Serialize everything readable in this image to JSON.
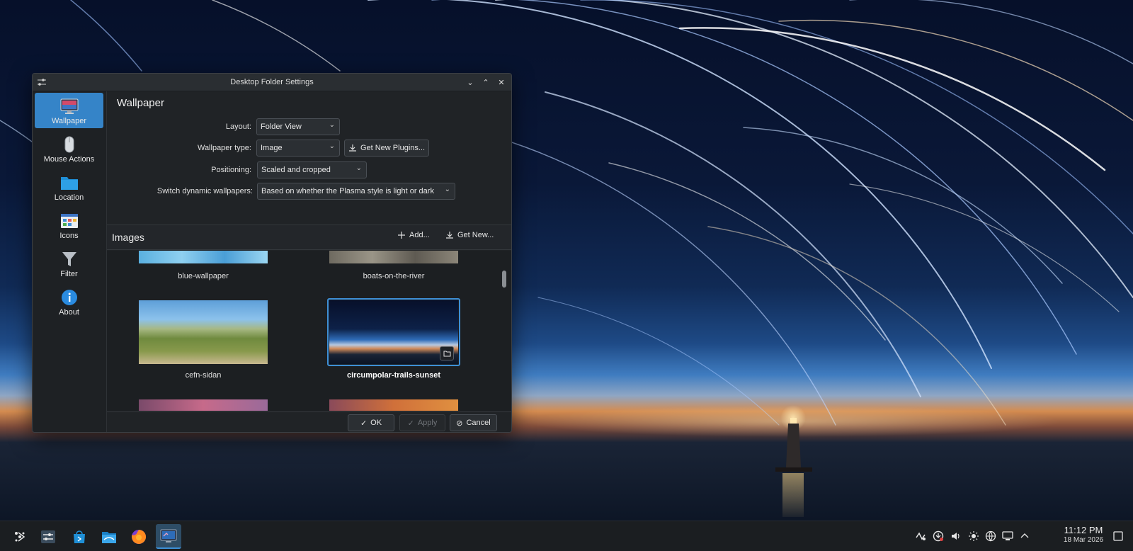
{
  "window": {
    "title": "Desktop Folder Settings",
    "controls": {
      "minimize": "⌄",
      "maximize": "⌃",
      "close": "✕"
    }
  },
  "sidebar": {
    "items": [
      {
        "label": "Wallpaper",
        "icon": "monitor-icon",
        "active": true
      },
      {
        "label": "Mouse Actions",
        "icon": "mouse-icon",
        "active": false
      },
      {
        "label": "Location",
        "icon": "folder-icon",
        "active": false
      },
      {
        "label": "Icons",
        "icon": "icons-grid-icon",
        "active": false
      },
      {
        "label": "Filter",
        "icon": "filter-icon",
        "active": false
      },
      {
        "label": "About",
        "icon": "info-icon",
        "active": false
      }
    ]
  },
  "main": {
    "heading": "Wallpaper",
    "layout": {
      "label": "Layout:",
      "value": "Folder View"
    },
    "wallpaper_type": {
      "label": "Wallpaper type:",
      "value": "Image",
      "plugins_button": "Get New Plugins..."
    },
    "positioning": {
      "label": "Positioning:",
      "value": "Scaled and cropped"
    },
    "dynamic": {
      "label": "Switch dynamic wallpapers:",
      "value": "Based on whether the Plasma style is light or dark"
    },
    "images": {
      "title": "Images",
      "add_button": "Add...",
      "get_new_button": "Get New...",
      "items": [
        {
          "name": "blue-wallpaper",
          "selected": false
        },
        {
          "name": "boats-on-the-river",
          "selected": false
        },
        {
          "name": "cefn-sidan",
          "selected": false
        },
        {
          "name": "circumpolar-trails-sunset",
          "selected": true
        }
      ]
    }
  },
  "footer": {
    "ok": "OK",
    "apply": "Apply",
    "cancel": "Cancel"
  },
  "taskbar": {
    "apps": [
      "application-launcher-icon",
      "system-settings-icon",
      "discover-store-icon",
      "dolphin-file-manager-icon",
      "firefox-icon",
      "plasma-settings-icon"
    ],
    "tray": [
      "kde-connect-icon",
      "updates-icon",
      "volume-icon",
      "brightness-icon",
      "network-icon",
      "display-icon",
      "expand-tray-icon"
    ],
    "clock": {
      "time": "11:12 PM",
      "date": "18 Mar 2026"
    }
  },
  "colors": {
    "accent": "#3584c8",
    "window_bg": "#202326",
    "selection": "#3d8fd6"
  }
}
